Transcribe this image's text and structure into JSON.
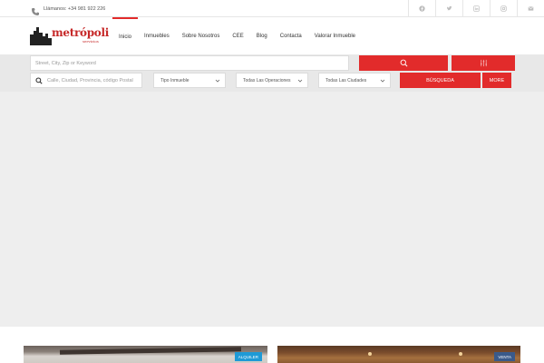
{
  "topbar": {
    "phone_text": "Llámanos: +34 981 922 226",
    "social": [
      {
        "icon": "facebook-icon"
      },
      {
        "icon": "twitter-icon"
      },
      {
        "icon": "linkedin-icon"
      },
      {
        "icon": "instagram-icon"
      },
      {
        "icon": "email-icon"
      }
    ]
  },
  "header": {
    "logo_text": "metrópoli",
    "logo_sub": "servicios",
    "nav": [
      {
        "label": "Inicio",
        "active": true
      },
      {
        "label": "Inmuebles"
      },
      {
        "label": "Sobre Nosotros"
      },
      {
        "label": "CEE"
      },
      {
        "label": "Blog"
      },
      {
        "label": "Contacta"
      },
      {
        "label": "Valorar Inmueble"
      }
    ]
  },
  "search": {
    "keyword_placeholder": "Street, City, Zip or Keyword",
    "address_placeholder": "Calle, Ciudad, Provincia, código Postal",
    "type_select": "Tipo Inmueble",
    "operations_select": "Todas Las Operaciones",
    "cities_select": "Todas Las Ciudades",
    "search_button": "BÚSQUEDA",
    "more_button": "MORE"
  },
  "listings": [
    {
      "tag": "ALQUILER"
    },
    {
      "tag": "VENTA"
    }
  ],
  "colors": {
    "accent": "#e22b2b",
    "alquiler_tag": "#1e9ad6",
    "venta_tag": "#3a5a8a"
  }
}
